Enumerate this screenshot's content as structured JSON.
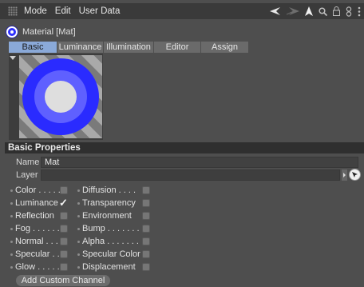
{
  "menu": {
    "items": [
      "Mode",
      "Edit",
      "User Data"
    ]
  },
  "toolbar": {
    "icons": [
      "back-arrow-icon",
      "forward-arrow-icon",
      "cursor-up-icon",
      "search-icon",
      "lock-icon",
      "link-icon"
    ]
  },
  "material": {
    "title": "Material [Mat]"
  },
  "tabs": [
    {
      "label": "Basic",
      "active": true
    },
    {
      "label": "Luminance",
      "active": false
    },
    {
      "label": "Illumination",
      "active": false
    },
    {
      "label": "Editor",
      "active": false
    },
    {
      "label": "Assign",
      "active": false
    }
  ],
  "section": {
    "title": "Basic Properties"
  },
  "fields": {
    "name_label": "Name",
    "name_value": "Mat",
    "layer_label": "Layer",
    "layer_value": ""
  },
  "channels": {
    "left": [
      {
        "label": "Color . . . . .",
        "checked": false
      },
      {
        "label": "Luminance",
        "checked": true
      },
      {
        "label": "Reflection",
        "checked": false
      },
      {
        "label": "Fog . . . . . .",
        "checked": false
      },
      {
        "label": "Normal . . .",
        "checked": false
      },
      {
        "label": "Specular . .",
        "checked": false
      },
      {
        "label": "Glow . . . . .",
        "checked": false
      }
    ],
    "right": [
      {
        "label": "Diffusion . . . .",
        "checked": false
      },
      {
        "label": "Transparency",
        "checked": false
      },
      {
        "label": "Environment",
        "checked": false
      },
      {
        "label": "Bump . . . . . . .",
        "checked": false
      },
      {
        "label": "Alpha . . . . . . .",
        "checked": false
      },
      {
        "label": "Specular Color",
        "checked": false
      },
      {
        "label": "Displacement",
        "checked": false
      }
    ]
  },
  "buttons": {
    "add_custom_channel": "Add Custom Channel"
  },
  "colors": {
    "accent_tab": "#8aa9d8",
    "material_blue": "#2f30ff"
  }
}
